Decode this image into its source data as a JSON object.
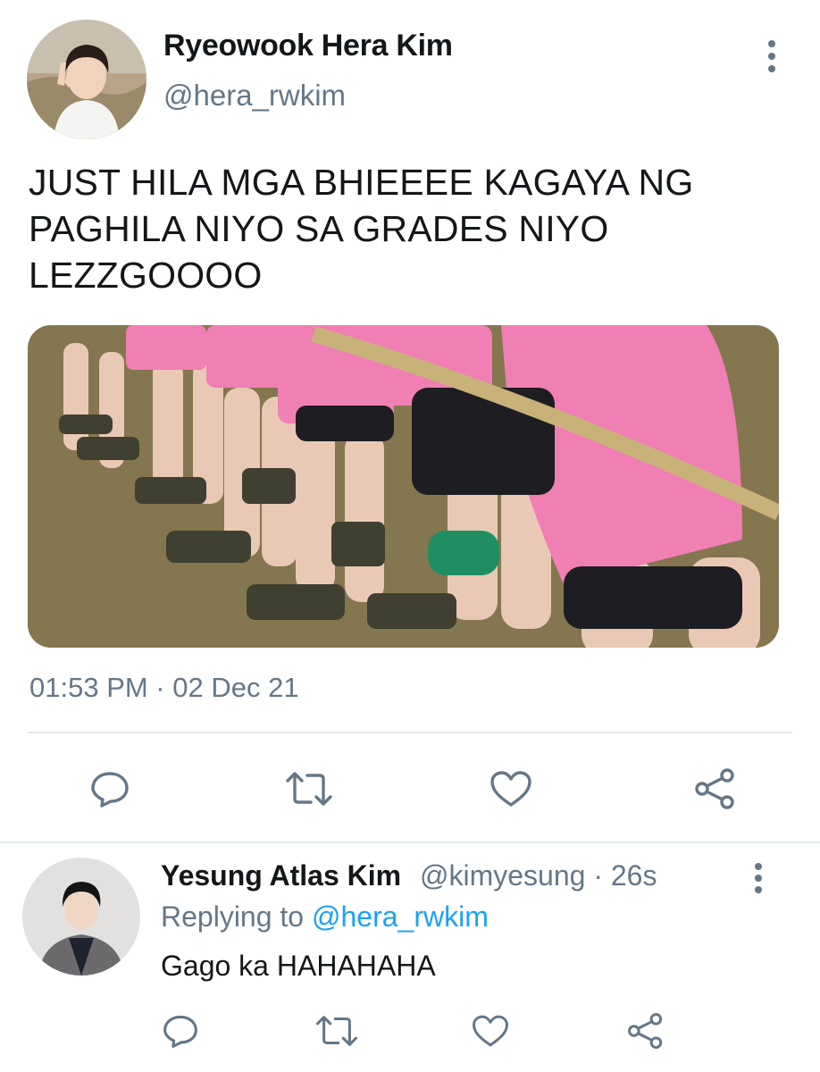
{
  "tweet": {
    "author_name": "Ryeowook Hera Kim",
    "author_handle": "@hera_rwkim",
    "text": "JUST HILA MGA BHIEEEE KAGAYA NG PAGHILA NIYO SA GRADES NIYO LEZZGOOOO",
    "timestamp": "01:53 PM · 02 Dec 21",
    "actions": [
      "reply-icon",
      "retweet-icon",
      "like-icon",
      "share-icon"
    ]
  },
  "reply": {
    "author_name": "Yesung Atlas Kim",
    "author_handle_time": "@kimyesung · 26s",
    "replying_prefix": "Replying to ",
    "replying_to": "@hera_rwkim",
    "text": "Gago ka HAHAHAHA",
    "actions": [
      "reply-icon",
      "retweet-icon",
      "like-icon",
      "share-icon"
    ]
  },
  "colors": {
    "text": "#14171a",
    "secondary": "#657786",
    "link": "#1da1f2",
    "divider": "#e1e8ed"
  }
}
